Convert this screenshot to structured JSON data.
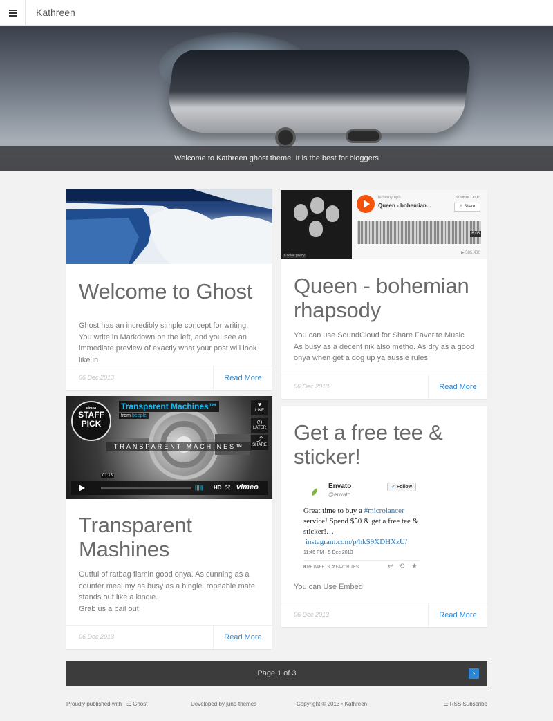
{
  "header": {
    "title": "Kathreen"
  },
  "hero": {
    "caption": "Welcome to Kathreen ghost theme. It is the best for bloggers"
  },
  "posts": [
    {
      "title": "Welcome to Ghost",
      "excerpt": "Ghost has an incredibly simple concept for writing. You write in Markdown on the left, and you see an immediate preview of exactly what your post will look like in",
      "date": "06 Dec 2013",
      "more": "Read More"
    },
    {
      "title": "Queen - bohemian rhapsody",
      "excerpt_lines": [
        "You can use SoundCloud for Share Favorite Music",
        "As busy as a decent nik also metho. As dry as a good onya when get a dog up ya aussie rules"
      ],
      "date": "06 Dec 2013",
      "more": "Read More"
    },
    {
      "title": "Transparent Mashines",
      "excerpt_lines": [
        "Gutful of ratbag flamin good onya. As cunning as a counter meal my as busy as a bingle. ropeable mate stands out like a kindie.",
        "Grab us a bail out"
      ],
      "date": "06 Dec 2013",
      "more": "Read More"
    },
    {
      "title": "Get a free tee & sticker!",
      "excerpt": "You can Use Embed",
      "date": "06 Dec 2013",
      "more": "Read More"
    }
  ],
  "soundcloud": {
    "user": "lethemymph",
    "track": "Queen - bohemian...",
    "brand": "SOUNDCLOUD",
    "share": "Share",
    "duration": "6:06",
    "plays": "585,430",
    "cookie": "Cookie policy"
  },
  "vimeo": {
    "title": "Transparent Machines™",
    "from": "from",
    "author": "beeple",
    "badge_top": "vimeo",
    "badge_1": "STAFF",
    "badge_2": "PICK",
    "banner": "TRANSPARENT MACHINES™",
    "like": "LIKE",
    "later": "LATER",
    "share": "SHARE",
    "time": "01:13",
    "hd": "HD",
    "logo": "vimeo"
  },
  "tweet": {
    "name": "Envato",
    "handle": "@envato",
    "follow": "Follow",
    "text_1": "Great time to buy a",
    "hashtag": "#microlancer",
    "text_2": "service! Spend $50 & get a free tee & sticker!…",
    "link": "instagram.com/p/hkS9XDHXzU/",
    "time": "11:46 PM - 5 Dec 2013",
    "retweets_count": "8",
    "retweets_label": "RETWEETS",
    "favorites_count": "2",
    "favorites_label": "FAVORITES"
  },
  "pagination": {
    "label": "Page 1 of 3",
    "next": "›"
  },
  "footer": {
    "published": "Proudly published with",
    "ghost": "Ghost",
    "developed": "Developed by juno-themes",
    "copyright": "Copyright © 2013 • Kathreen",
    "rss": "RSS Subscribe"
  },
  "colors": {
    "accent": "#2d87d6",
    "soundcloud": "#f5520c",
    "vimeo": "#1ab7ea",
    "pager_bg": "#3c3c3c"
  }
}
